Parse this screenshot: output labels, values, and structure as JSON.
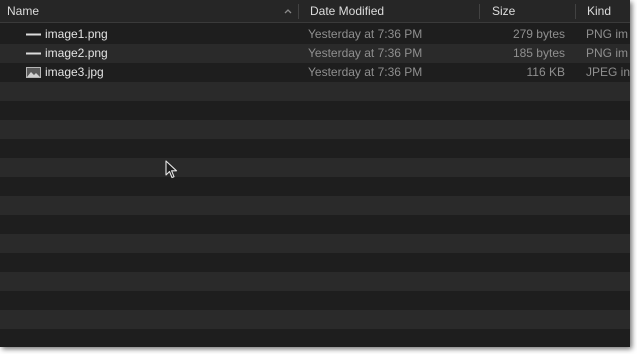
{
  "columns": {
    "name": "Name",
    "date": "Date Modified",
    "size": "Size",
    "kind": "Kind"
  },
  "sort": {
    "column": "name",
    "direction": "ascending",
    "icon": "chevron-up-icon"
  },
  "files": [
    {
      "name": "image1.png",
      "date": "Yesterday at 7:36 PM",
      "size": "279 bytes",
      "kind": "PNG im",
      "icon": "line-thumbnail-icon"
    },
    {
      "name": "image2.png",
      "date": "Yesterday at 7:36 PM",
      "size": "185 bytes",
      "kind": "PNG im",
      "icon": "line-thumbnail-icon"
    },
    {
      "name": "image3.jpg",
      "date": "Yesterday at 7:36 PM",
      "size": "116 KB",
      "kind": "JPEG in",
      "icon": "image-thumbnail-icon"
    }
  ],
  "colors": {
    "background": "#1e1e1e",
    "alt_row": "#2a2a2a",
    "header": "#262626",
    "name_text": "#e3e3e3",
    "secondary_text": "#8f8f8f"
  }
}
